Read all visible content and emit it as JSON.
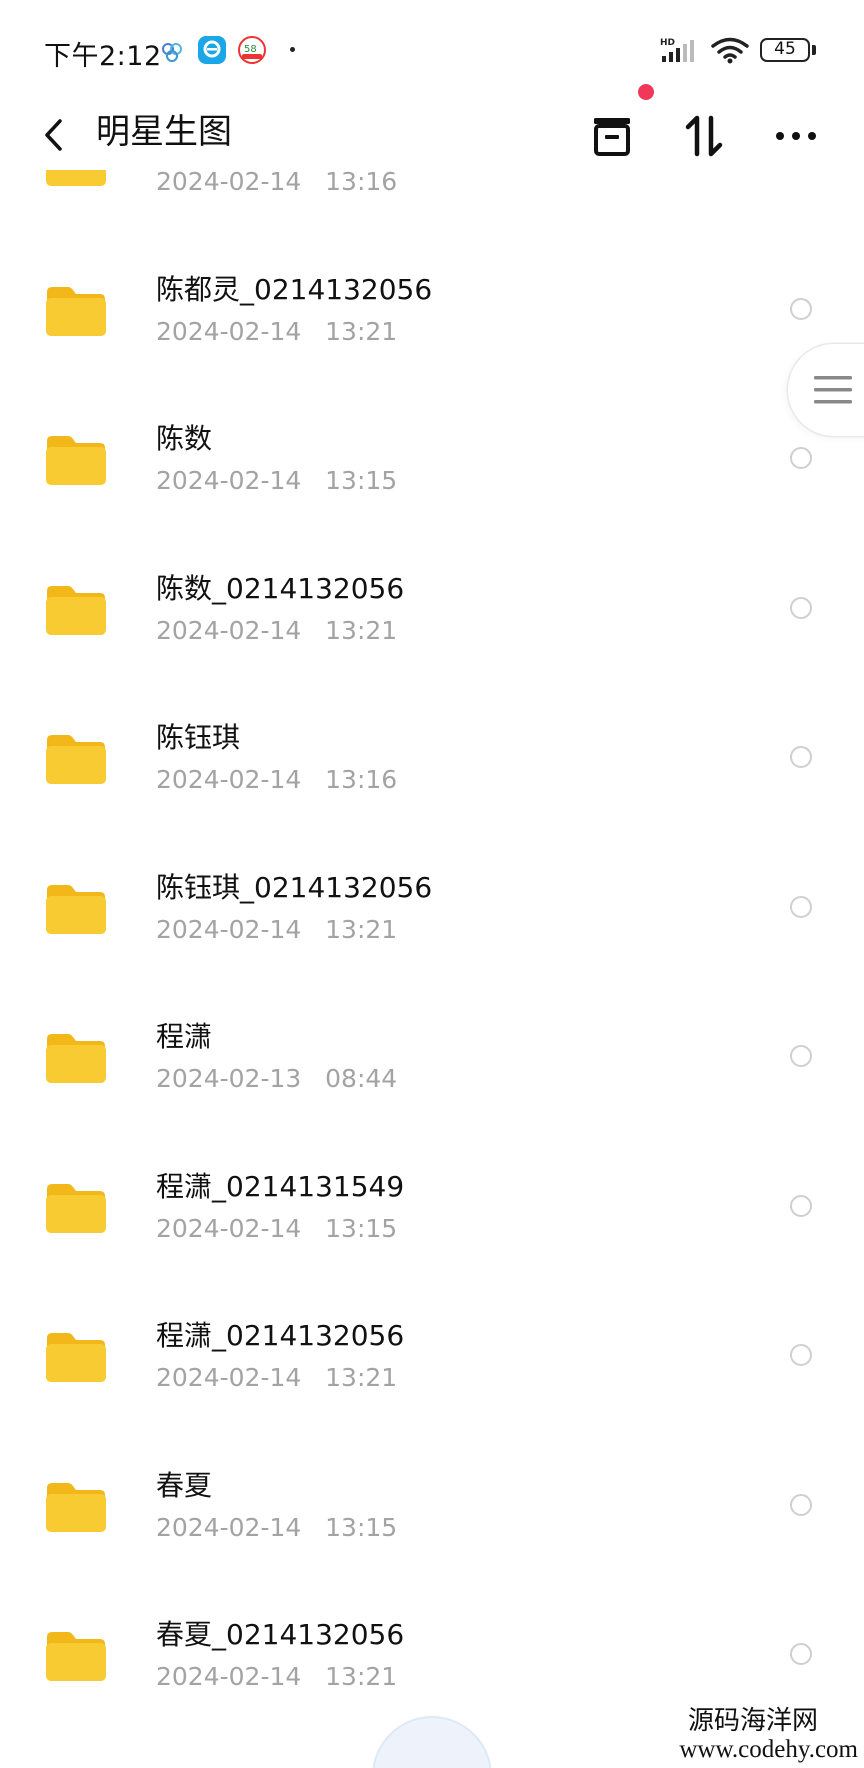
{
  "status_bar": {
    "time": "下午2:12",
    "signal_label": "HD",
    "battery": "45",
    "icons": [
      "app-icon-1",
      "app-icon-2",
      "app-icon-58",
      "signal-icon",
      "wifi-icon",
      "battery-icon"
    ]
  },
  "app_bar": {
    "title": "明星生图",
    "back_icon": "chevron-left-icon",
    "actions": [
      "archive-icon",
      "sort-icon",
      "more-icon"
    ]
  },
  "colors": {
    "folder": "#f9cb33",
    "folder_dark": "#f2b81a",
    "date_text": "#a3a3a3",
    "notification_dot": "#f0385a",
    "background": "#ffffff"
  },
  "files": [
    {
      "name": "",
      "date": "2024-02-14   13:16"
    },
    {
      "name": "陈都灵_0214132056",
      "date": "2024-02-14   13:21"
    },
    {
      "name": "陈数",
      "date": "2024-02-14   13:15"
    },
    {
      "name": "陈数_0214132056",
      "date": "2024-02-14   13:21"
    },
    {
      "name": "陈钰琪",
      "date": "2024-02-14   13:16"
    },
    {
      "name": "陈钰琪_0214132056",
      "date": "2024-02-14   13:21"
    },
    {
      "name": "程潇",
      "date": "2024-02-13   08:44"
    },
    {
      "name": "程潇_0214131549",
      "date": "2024-02-14   13:15"
    },
    {
      "name": "程潇_0214132056",
      "date": "2024-02-14   13:21"
    },
    {
      "name": "春夏",
      "date": "2024-02-14   13:15"
    },
    {
      "name": "春夏_0214132056",
      "date": "2024-02-14   13:21"
    }
  ],
  "watermark": {
    "line1": "源码海洋网",
    "line2": "www.codehy.com"
  }
}
